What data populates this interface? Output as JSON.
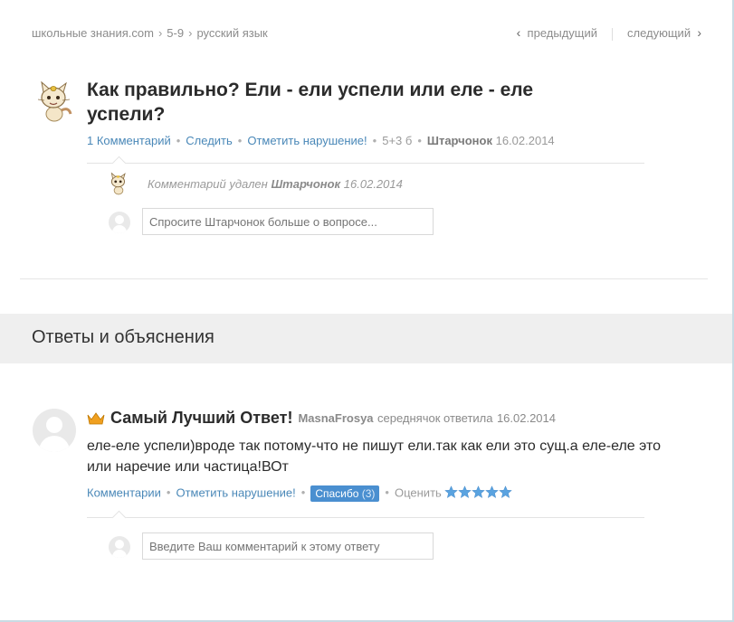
{
  "breadcrumb": {
    "site": "школьные знания.com",
    "grade": "5-9",
    "subject": "русский язык"
  },
  "pager": {
    "prev": "предыдущий",
    "next": "следующий"
  },
  "question": {
    "title": "Как правильно? Ели - ели успели или еле - еле успели?",
    "comments_link": "1 Комментарий",
    "follow_link": "Следить",
    "report_link": "Отметить нарушение!",
    "points": "5+3 б",
    "author": "Штарчонок",
    "date": "16.02.2014"
  },
  "question_comment": {
    "deleted_text": "Комментарий удален",
    "author": "Штарчонок",
    "date": "16.02.2014"
  },
  "question_comment_input": {
    "placeholder": "Спросите Штарчонок больше о вопросе..."
  },
  "answers_section": {
    "title": "Ответы и объяснения"
  },
  "answer": {
    "badge": "Самый Лучший Ответ!",
    "author": "MasnaFrosya",
    "rank_action": "середнячок ответила",
    "date": "16.02.2014",
    "text": "еле-еле успели)вроде так потому-что не пишут ели.так как ели это сущ.а еле-еле это или наречие или частица!ВОт",
    "comments_link": "Комментарии",
    "report_link": "Отметить нарушение!",
    "thanks_label": "Спасибо",
    "thanks_count": "(3)",
    "rate_label": "Оценить",
    "stars": 5,
    "star_color": "#5aa3e0"
  },
  "answer_comment_input": {
    "placeholder": "Введите Ваш комментарий к этому ответу"
  },
  "colors": {
    "link": "#4a88b8",
    "band": "#efefef",
    "crown": "#f0a020"
  }
}
